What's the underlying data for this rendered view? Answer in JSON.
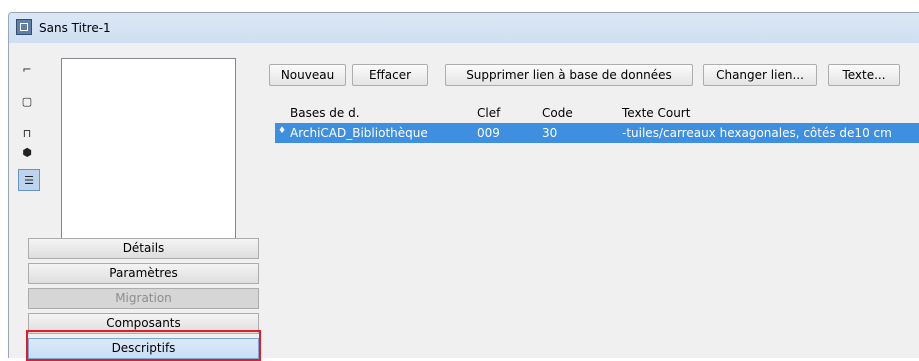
{
  "window": {
    "title": "Sans Titre-1"
  },
  "toolbar": {
    "nouveau": "Nouveau",
    "effacer": "Effacer",
    "supprimer": "Supprimer lien à base de données",
    "changer": "Changer lien...",
    "texte": "Texte..."
  },
  "table": {
    "headers": [
      "Bases de d.",
      "Clef",
      "Code",
      "Texte Court"
    ],
    "rows": [
      [
        "ArchiCAD_Bibliothèque",
        "009",
        "30",
        "-tuiles/carreaux hexagonales, côtés de10 cm"
      ]
    ],
    "selected_row": 0
  },
  "side_panel": {
    "buttons": [
      "Détails",
      "Paramètres",
      "Migration",
      "Composants",
      "Descriptifs"
    ],
    "disabled": [
      "Migration"
    ],
    "active": "Descriptifs"
  },
  "tools": [
    {
      "name": "line-tool-icon",
      "glyph": "⌐"
    },
    {
      "name": "rectangle-tool-icon",
      "glyph": "▢"
    },
    {
      "name": "column-tool-icon",
      "glyph": "⊓"
    },
    {
      "name": "object-tool-icon",
      "glyph": "⬢"
    },
    {
      "name": "list-tool-icon",
      "glyph": "☰"
    }
  ],
  "colors": {
    "selection": "#3f8fe0",
    "highlight_frame": "#e11d2a",
    "titlebar": "#d6e4f4"
  }
}
